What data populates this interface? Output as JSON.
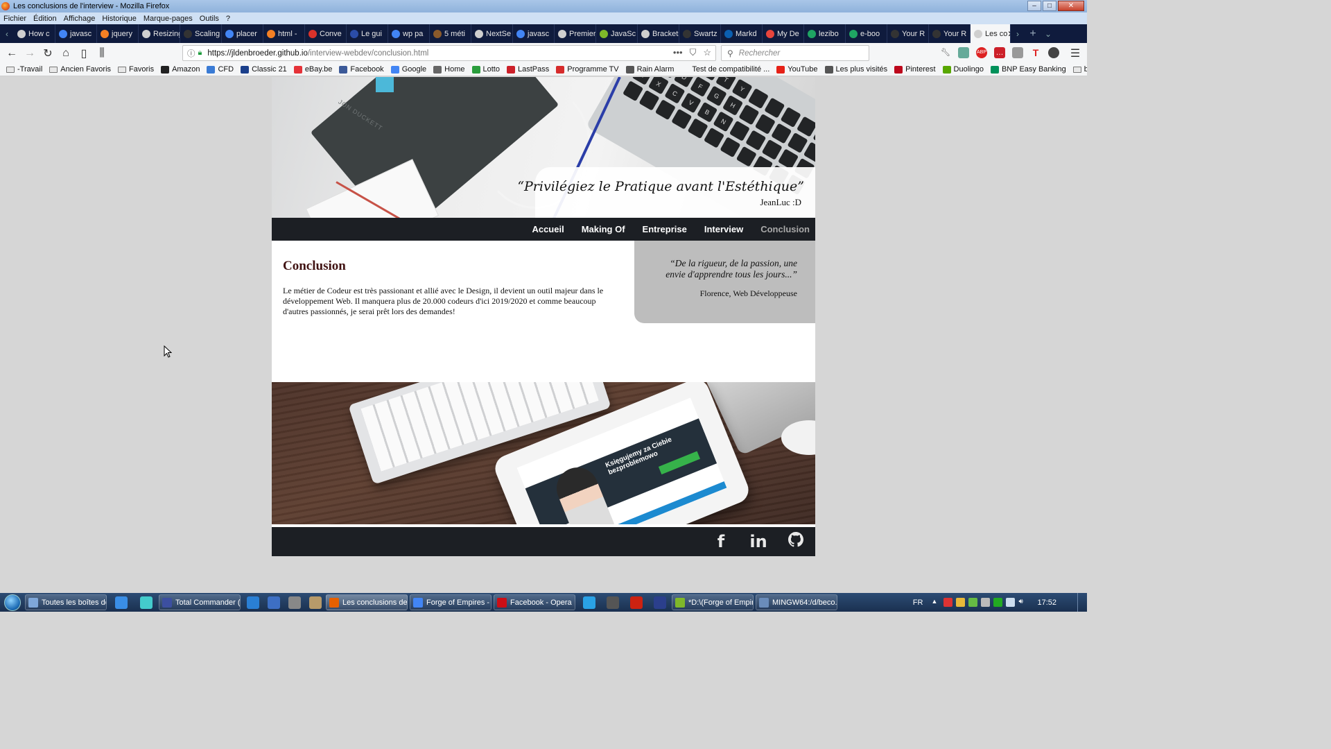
{
  "window": {
    "title": "Les conclusions de l'interview - Mozilla Firefox"
  },
  "menu": [
    "Fichier",
    "Édition",
    "Affichage",
    "Historique",
    "Marque-pages",
    "Outils",
    "?"
  ],
  "tabs": [
    {
      "label": "How c",
      "color": "#cfcfcf"
    },
    {
      "label": "javasc",
      "color": "#4285f4"
    },
    {
      "label": "jquery",
      "color": "#f48024"
    },
    {
      "label": "Resizing th",
      "color": "#cfcfcf"
    },
    {
      "label": "Scaling",
      "color": "#333333"
    },
    {
      "label": "placer",
      "color": "#4285f4"
    },
    {
      "label": "html -",
      "color": "#f48024"
    },
    {
      "label": "Conve",
      "color": "#d9322b"
    },
    {
      "label": "Le gui",
      "color": "#2b4da8"
    },
    {
      "label": "wp pa",
      "color": "#4285f4"
    },
    {
      "label": "5 méti",
      "color": "#8a5a2b"
    },
    {
      "label": "NextSe",
      "color": "#cfcfcf"
    },
    {
      "label": "javasc",
      "color": "#4285f4"
    },
    {
      "label": "Premiers p",
      "color": "#cfcfcf"
    },
    {
      "label": "JavaSc",
      "color": "#7fb82a"
    },
    {
      "label": "Brackets Ex",
      "color": "#cfcfcf"
    },
    {
      "label": "Swartz",
      "color": "#333333"
    },
    {
      "label": "Markd",
      "color": "#0b5fb0"
    },
    {
      "label": "My De",
      "color": "#e8453c"
    },
    {
      "label": "lezibo",
      "color": "#1fa463"
    },
    {
      "label": "e-boo",
      "color": "#1fa463"
    },
    {
      "label": "Your R",
      "color": "#333333"
    },
    {
      "label": "Your R",
      "color": "#333333"
    },
    {
      "label": "Les co",
      "color": "#cfcfcf",
      "active": true
    }
  ],
  "nav": {
    "url_host": "https://jldenbroeder.github.io",
    "url_path": "/interview-webdev/conclusion.html",
    "search_placeholder": "Rechercher",
    "more_icon": "•••"
  },
  "bookmarks": [
    {
      "label": "-Travail",
      "icon": "folder"
    },
    {
      "label": "Ancien Favoris",
      "icon": "folder"
    },
    {
      "label": "Favoris",
      "icon": "folder"
    },
    {
      "label": "Amazon",
      "icon": "amazon",
      "color": "#222222"
    },
    {
      "label": "CFD",
      "icon": "cfd",
      "color": "#3a7bd5"
    },
    {
      "label": "Classic 21",
      "icon": "classic21",
      "color": "#1b3f8b"
    },
    {
      "label": "eBay.be",
      "icon": "ebay",
      "color": "#e53238"
    },
    {
      "label": "Facebook",
      "icon": "facebook",
      "color": "#3b5998"
    },
    {
      "label": "Google",
      "icon": "google",
      "color": "#4285f4"
    },
    {
      "label": "Home",
      "icon": "home",
      "color": "#666666"
    },
    {
      "label": "Lotto",
      "icon": "lotto",
      "color": "#2a9d3c"
    },
    {
      "label": "LastPass",
      "icon": "lastpass",
      "color": "#cc2029"
    },
    {
      "label": "Programme TV",
      "icon": "tv",
      "color": "#d62b2b"
    },
    {
      "label": "Rain Alarm",
      "icon": "rain",
      "color": "#555555"
    },
    {
      "label": "Test de compatibilité ...",
      "icon": "none",
      "color": "#f5f6f7"
    },
    {
      "label": "YouTube",
      "icon": "youtube",
      "color": "#e62117"
    },
    {
      "label": "Les plus visités",
      "icon": "gear",
      "color": "#555555"
    },
    {
      "label": "Pinterest",
      "icon": "pinterest",
      "color": "#bd081c"
    },
    {
      "label": "Duolingo",
      "icon": "duolingo",
      "color": "#58a700"
    },
    {
      "label": "BNP Easy Banking",
      "icon": "bnp",
      "color": "#00915a"
    },
    {
      "label": "becode",
      "icon": "folder"
    }
  ],
  "site": {
    "hero_quote": "“Privilégiez le Pratique avant l'Estéthique”",
    "hero_author": "JeanLuc :D",
    "notebook_text": "JON DUCKETT",
    "nav_items": [
      {
        "label": "Accueil",
        "current": false
      },
      {
        "label": "Making Of",
        "current": false
      },
      {
        "label": "Entreprise",
        "current": false
      },
      {
        "label": "Interview",
        "current": false
      },
      {
        "label": "Conclusion",
        "current": true
      }
    ],
    "heading": "Conclusion",
    "body": "Le métier de Codeur est très passionant et allié avec le Design, il devient un outil majeur dans le développement Web. Il manquera plus de 20.000 codeurs d'ici 2019/2020 et comme beaucoup d'autres passionnés, je serai prêt lors des demandes!",
    "aside_quote": "“De la rigueur, de la passion, une envie d'apprendre tous les jours...”",
    "aside_author": "Florence, Web Développeuse",
    "tablet_headline": "Księgujemy za Ciebie bezproblemowo",
    "social": [
      {
        "name": "facebook-icon",
        "glyph": "f"
      },
      {
        "name": "linkedin-icon",
        "glyph": "in"
      },
      {
        "name": "github-icon",
        "glyph": "◉"
      }
    ]
  },
  "taskbar": {
    "items": [
      {
        "label": "Toutes les boîtes de...",
        "color": "#7fa7d9",
        "width": 118
      },
      {
        "label": "Total Commander (...",
        "color": "#3c4fa0",
        "width": 118
      },
      {
        "label": "Les conclusions de ...",
        "color": "#e66000",
        "width": 118,
        "active": true
      },
      {
        "label": "Forge of Empires - ...",
        "color": "#4285f4",
        "width": 118
      },
      {
        "label": "Facebook - Opera",
        "color": "#cc0f16",
        "width": 118
      },
      {
        "label": "*D:\\(Forge of Empir...",
        "color": "#7fb82a",
        "width": 118
      },
      {
        "label": "MINGW64:/d/beco...",
        "color": "#6a8cba",
        "width": 118
      }
    ],
    "language": "FR",
    "clock": "17:52"
  }
}
